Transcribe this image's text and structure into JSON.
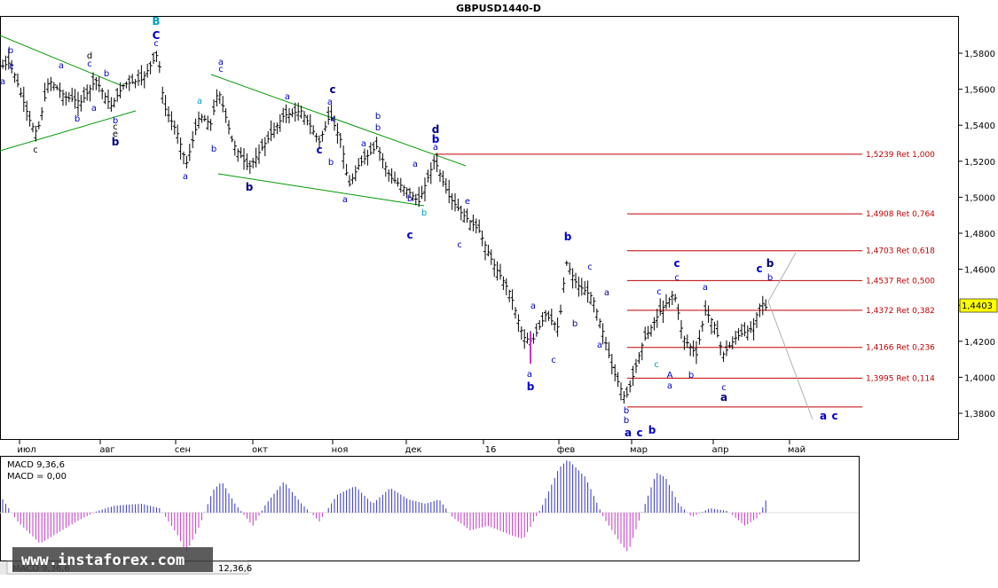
{
  "chart_data": {
    "type": "bar",
    "title": "GBPUSD1440-D",
    "current_price": "1,4403",
    "y_ticks": [
      "1,5800",
      "1,5600",
      "1,5400",
      "1,5200",
      "1,5000",
      "1,4800",
      "1,4600",
      "1,4400",
      "1,4200",
      "1,4000",
      "1,3800"
    ],
    "x_ticks": [
      "июл",
      "авг",
      "сен",
      "окт",
      "ноя",
      "дек",
      "16",
      "фев",
      "мар",
      "апр",
      "май"
    ],
    "fib_levels": [
      {
        "price": 1.5239,
        "label": "1,5239 Ret 1,000"
      },
      {
        "price": 1.4908,
        "label": "1,4908 Ret 0,764"
      },
      {
        "price": 1.4703,
        "label": "1,4703 Ret 0,618"
      },
      {
        "price": 1.4537,
        "label": "1,4537 Ret 0,500"
      },
      {
        "price": 1.4372,
        "label": "1,4372 Ret 0,382"
      },
      {
        "price": 1.4166,
        "label": "1,4166 Ret 0,236"
      },
      {
        "price": 1.3995,
        "label": "1,3995 Ret 0,114"
      },
      {
        "price": 1.3835,
        "label": ""
      }
    ],
    "wave_labels": [
      {
        "text": "b",
        "color": "#0000cc"
      },
      {
        "text": "a",
        "color": "#0000cc"
      },
      {
        "text": "c",
        "color": "#0000cc"
      },
      {
        "text": "a",
        "color": "#0000cc"
      },
      {
        "text": "c",
        "color": "#000000"
      },
      {
        "text": "d",
        "color": "#000000"
      },
      {
        "text": "c",
        "color": "#0000cc"
      },
      {
        "text": "b",
        "color": "#0000cc"
      },
      {
        "text": "b",
        "color": "#0000cc"
      },
      {
        "text": "a",
        "color": "#0000cc"
      },
      {
        "text": "b",
        "color": "#0000cc"
      },
      {
        "text": "c",
        "color": "#000000"
      },
      {
        "text": "e",
        "color": "#000000"
      },
      {
        "text": "b",
        "color": "#000080"
      },
      {
        "text": "B",
        "color": "#00a0c0"
      },
      {
        "text": "C",
        "color": "#0000cc"
      },
      {
        "text": "c",
        "color": "#0000cc"
      },
      {
        "text": "a",
        "color": "#0000cc"
      },
      {
        "text": "b",
        "color": "#0000cc"
      },
      {
        "text": "a",
        "color": "#00a0c0"
      },
      {
        "text": "a",
        "color": "#0000cc"
      },
      {
        "text": "c",
        "color": "#0000cc"
      },
      {
        "text": "b",
        "color": "#000080"
      },
      {
        "text": "a",
        "color": "#0000cc"
      },
      {
        "text": "c",
        "color": "#000080"
      },
      {
        "text": "a",
        "color": "#0000cc"
      },
      {
        "text": "b",
        "color": "#0000cc"
      },
      {
        "text": "a",
        "color": "#0000cc"
      },
      {
        "text": "c",
        "color": "#0000cc"
      },
      {
        "text": "b",
        "color": "#0000cc"
      },
      {
        "text": "a",
        "color": "#0000cc"
      },
      {
        "text": "b",
        "color": "#0000cc"
      },
      {
        "text": "c",
        "color": "#0000cc"
      },
      {
        "text": "a",
        "color": "#0000cc"
      },
      {
        "text": "b",
        "color": "#0000cc"
      },
      {
        "text": "c",
        "color": "#0000cc"
      },
      {
        "text": "d",
        "color": "#000080"
      },
      {
        "text": "b",
        "color": "#0000cc"
      },
      {
        "text": "a",
        "color": "#0000cc"
      },
      {
        "text": "b",
        "color": "#00a0c0"
      },
      {
        "text": "e",
        "color": "#0000cc"
      },
      {
        "text": "c",
        "color": "#0000cc"
      },
      {
        "text": "b",
        "color": "#0000cc"
      },
      {
        "text": "a",
        "color": "#0000cc"
      },
      {
        "text": "a",
        "color": "#0000cc"
      },
      {
        "text": "b",
        "color": "#0000cc"
      },
      {
        "text": "c",
        "color": "#0000cc"
      },
      {
        "text": "a",
        "color": "#000080"
      },
      {
        "text": "b",
        "color": "#000080"
      },
      {
        "text": "c",
        "color": "#0000cc"
      },
      {
        "text": "a",
        "color": "#0000cc"
      },
      {
        "text": "b",
        "color": "#0000cc"
      },
      {
        "text": "b",
        "color": "#0000cc"
      },
      {
        "text": "a",
        "color": "#0000cc"
      },
      {
        "text": "c",
        "color": "#0000cc"
      },
      {
        "text": "b",
        "color": "#0000cc"
      },
      {
        "text": "c",
        "color": "#0000cc"
      },
      {
        "text": "c",
        "color": "#0000cc"
      },
      {
        "text": "c",
        "color": "#0000cc"
      },
      {
        "text": "c",
        "color": "#00a0c0"
      },
      {
        "text": "A",
        "color": "#0000cc"
      },
      {
        "text": "a",
        "color": "#0000cc"
      },
      {
        "text": "b",
        "color": "#0000cc"
      },
      {
        "text": "a",
        "color": "#0000cc"
      },
      {
        "text": "c",
        "color": "#0000cc"
      },
      {
        "text": "a",
        "color": "#000080"
      },
      {
        "text": "c",
        "color": "#0000cc"
      },
      {
        "text": "b",
        "color": "#000080"
      },
      {
        "text": "b",
        "color": "#0000cc"
      },
      {
        "text": "a",
        "color": "#0000cc"
      },
      {
        "text": "c",
        "color": "#0000cc"
      },
      {
        "text": "b",
        "color": "#000080"
      },
      {
        "text": "?",
        "color": "#000080"
      },
      {
        "text": "B",
        "color": "#0000cc"
      },
      {
        "text": "c",
        "color": "#0000cc"
      },
      {
        "text": "C",
        "color": "#0000cc"
      },
      {
        "text": "C",
        "color": "#00a0c0"
      }
    ],
    "grid": false,
    "colors": {
      "candles": "#000000",
      "fib": "#c00000",
      "trend": "#009900",
      "macd_pos": "#3333cc",
      "macd_neg": "#cc33cc",
      "projection": "#b0b0b0"
    }
  },
  "macd": {
    "label1": "MACD 9,36,6",
    "label2": "MACD = 0,00",
    "tab_text": "MACD 9,36,6",
    "tab_value": "12,36,6"
  },
  "watermark": "www.instaforex.com"
}
